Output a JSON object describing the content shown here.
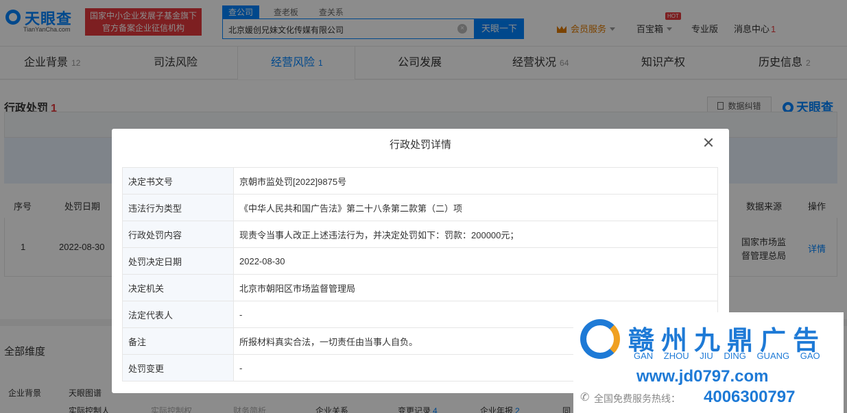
{
  "header": {
    "logo_text": "天眼查",
    "logo_sub": "TianYanCha.com",
    "badge_line1": "国家中小企业发展子基金旗下",
    "badge_line2": "官方备案企业征信机构",
    "search_tabs": [
      "查公司",
      "查老板",
      "查关系"
    ],
    "search_value": "北京媛创兄妹文化传媒有限公司",
    "search_button": "天眼一下",
    "vip_label": "会员服务",
    "treasure_label": "百宝箱",
    "hot_badge": "HOT",
    "pro_label": "专业版",
    "msg_label": "消息中心",
    "msg_count": "1"
  },
  "nav": {
    "tabs": [
      {
        "label": "企业背景",
        "count": "12"
      },
      {
        "label": "司法风险",
        "count": ""
      },
      {
        "label": "经营风险",
        "count": "1"
      },
      {
        "label": "公司发展",
        "count": ""
      },
      {
        "label": "经营状况",
        "count": "64"
      },
      {
        "label": "知识产权",
        "count": ""
      },
      {
        "label": "历史信息",
        "count": "2"
      }
    ]
  },
  "section": {
    "title": "行政处罚",
    "count": "1",
    "feedback_button": "数据纠错",
    "brand": "天眼查"
  },
  "table": {
    "headers": {
      "index": "序号",
      "date": "处罚日期",
      "source": "数据来源",
      "action": "操作"
    },
    "row": {
      "index": "1",
      "date": "2022-08-30",
      "source_line1": "国家市场监",
      "source_line2": "督管理总局",
      "action": "详情"
    }
  },
  "dimensions": {
    "title": "全部维度",
    "items": [
      {
        "label": "企业背景",
        "count": ""
      },
      {
        "label": "天眼图谱",
        "count": ""
      },
      {
        "label": "实际控制人",
        "count": ""
      },
      {
        "label": "实际控制权",
        "count": ""
      },
      {
        "label": "财务简析",
        "count": ""
      },
      {
        "label": "企业关系",
        "count": ""
      },
      {
        "label": "变更记录",
        "count": "4"
      },
      {
        "label": "企业年报",
        "count": "2"
      },
      {
        "label": "同",
        "count": ""
      }
    ]
  },
  "modal": {
    "title": "行政处罚详情",
    "rows": [
      {
        "key": "决定书文号",
        "value": "京朝市监处罚[2022]9875号"
      },
      {
        "key": "违法行为类型",
        "value": "《中华人民共和国广告法》第二十八条第二款第（二）项"
      },
      {
        "key": "行政处罚内容",
        "value": "现责令当事人改正上述违法行为，并决定处罚如下：罚款：200000元；"
      },
      {
        "key": "处罚决定日期",
        "value": "2022-08-30"
      },
      {
        "key": "决定机关",
        "value": "北京市朝阳区市场监督管理局"
      },
      {
        "key": "法定代表人",
        "value": "-"
      },
      {
        "key": "备注",
        "value": "所报材料真实合法，一切责任由当事人自负。"
      },
      {
        "key": "处罚变更",
        "value": "-"
      }
    ]
  },
  "ad": {
    "name_cn": "赣州九鼎广告",
    "name_py": "GAN ZHOU JIU DING GUANG GAO",
    "url": "www.jd0797.com",
    "phone_label": "全国免费服务热线：",
    "phone": "4006300797"
  }
}
